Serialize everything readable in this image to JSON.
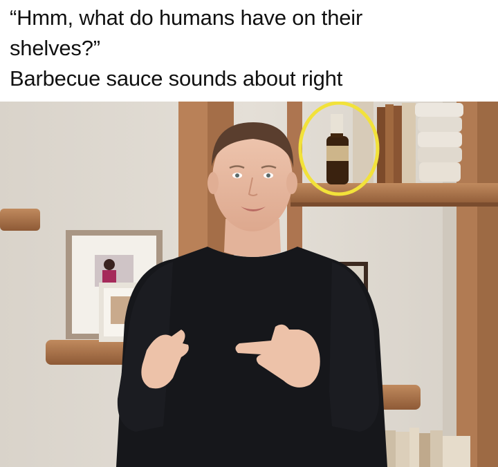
{
  "caption": {
    "line1": "“Hmm, what do humans have on their",
    "line2": "shelves?”",
    "line3": "Barbecue sauce sounds about right"
  },
  "photo": {
    "subject": "man-in-black-sweater",
    "highlight": "barbecue-sauce-bottle",
    "highlight_color": "#f2e23a",
    "wall_color": "#ddd8d0",
    "wood_color": "#b07850",
    "sweater_color": "#15161a"
  }
}
